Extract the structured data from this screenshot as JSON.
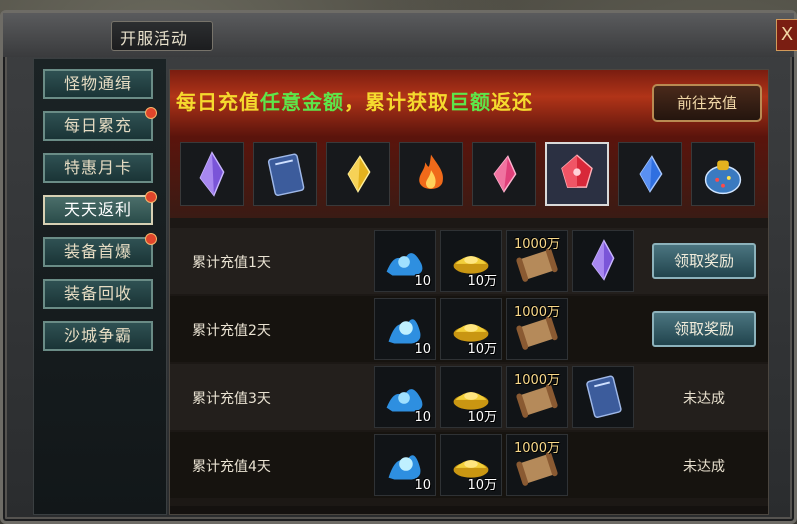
{
  "window": {
    "title": "开服活动",
    "close_label": "X"
  },
  "sidebar": {
    "items": [
      {
        "label": "怪物通缉",
        "badge": false,
        "active": false
      },
      {
        "label": "每日累充",
        "badge": true,
        "active": false
      },
      {
        "label": "特惠月卡",
        "badge": false,
        "active": false
      },
      {
        "label": "天天返利",
        "badge": true,
        "active": true
      },
      {
        "label": "装备首爆",
        "badge": true,
        "active": false
      },
      {
        "label": "装备回收",
        "badge": false,
        "active": false
      },
      {
        "label": "沙城争霸",
        "badge": false,
        "active": false
      }
    ]
  },
  "banner": {
    "text_parts": [
      "每日充值",
      "任意金额",
      "，累计获取",
      "巨额",
      "返还"
    ],
    "recharge_button": "前往充值"
  },
  "showcase_items": [
    {
      "icon": "purple-crystal-icon",
      "color": "#7a55d8"
    },
    {
      "icon": "blue-book-icon",
      "color": "#3c5c9c"
    },
    {
      "icon": "yellow-gem-icon",
      "color": "#e3b21e"
    },
    {
      "icon": "fire-icon",
      "color": "#f06a1a"
    },
    {
      "icon": "pink-gem-icon",
      "color": "#e0407a"
    },
    {
      "icon": "red-gem-icon",
      "color": "#d8283a"
    },
    {
      "icon": "blue-gem-icon",
      "color": "#2f6fe0"
    },
    {
      "icon": "treasure-bag-icon",
      "color": "#3a7ac0"
    }
  ],
  "rows": [
    {
      "label": "累计充值1天",
      "rewards": [
        {
          "icon": "blue-spirit-icon",
          "qty": "10"
        },
        {
          "icon": "gold-ingot-icon",
          "qty": "10万"
        },
        {
          "icon": "scroll-icon",
          "top": "1000万"
        },
        {
          "icon": "purple-crystal-icon"
        }
      ],
      "action": "领取奖励",
      "claimable": true
    },
    {
      "label": "累计充值2天",
      "rewards": [
        {
          "icon": "blue-spirit-icon",
          "qty": "10"
        },
        {
          "icon": "gold-ingot-icon",
          "qty": "10万"
        },
        {
          "icon": "scroll-icon",
          "top": "1000万"
        }
      ],
      "action": "领取奖励",
      "claimable": true
    },
    {
      "label": "累计充值3天",
      "rewards": [
        {
          "icon": "blue-spirit-icon",
          "qty": "10"
        },
        {
          "icon": "gold-ingot-icon",
          "qty": "10万"
        },
        {
          "icon": "scroll-icon",
          "top": "1000万"
        },
        {
          "icon": "blue-book-icon"
        }
      ],
      "action": "未达成",
      "claimable": false
    },
    {
      "label": "累计充值4天",
      "rewards": [
        {
          "icon": "blue-spirit-icon",
          "qty": "10"
        },
        {
          "icon": "gold-ingot-icon",
          "qty": "10万"
        },
        {
          "icon": "scroll-icon",
          "top": "1000万"
        }
      ],
      "action": "未达成",
      "claimable": false
    }
  ]
}
